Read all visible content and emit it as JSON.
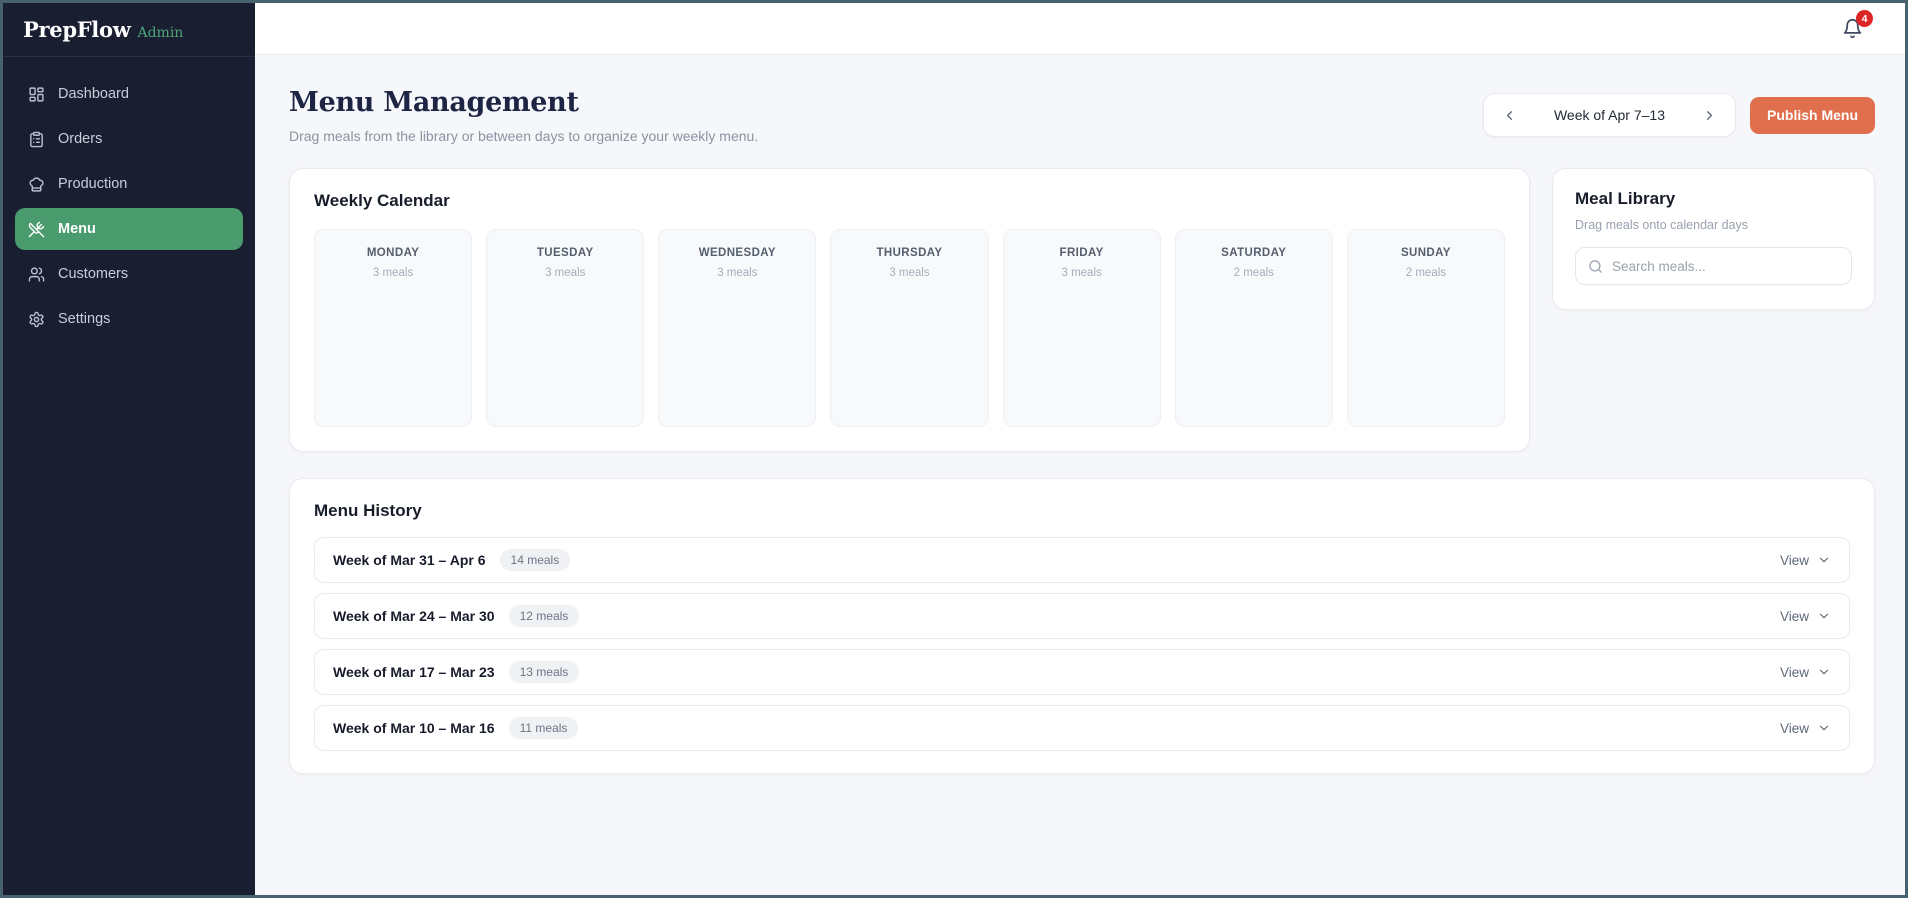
{
  "app": {
    "name": "PrepFlow",
    "suffix": "Admin"
  },
  "colors": {
    "sidebar_bg": "#1a1e31",
    "accent_green": "#4a9b6e",
    "accent_orange": "#e0704d",
    "badge_red": "#dc2626",
    "page_bg": "#f6f7fa"
  },
  "sidebar": {
    "items": [
      {
        "label": "Dashboard",
        "icon": "dashboard-icon",
        "active": false
      },
      {
        "label": "Orders",
        "icon": "clipboard-icon",
        "active": false
      },
      {
        "label": "Production",
        "icon": "chef-hat-icon",
        "active": false
      },
      {
        "label": "Menu",
        "icon": "utensils-icon",
        "active": true
      },
      {
        "label": "Customers",
        "icon": "users-icon",
        "active": false
      },
      {
        "label": "Settings",
        "icon": "gear-icon",
        "active": false
      }
    ]
  },
  "topbar": {
    "notification_count": "4"
  },
  "header": {
    "title": "Menu Management",
    "subtitle": "Drag meals from the library or between days to organize your weekly menu.",
    "week_label": "Week of Apr 7–13",
    "publish_label": "Publish Menu"
  },
  "calendar": {
    "title": "Weekly Calendar",
    "days": [
      {
        "name": "MONDAY",
        "meals": "3 meals"
      },
      {
        "name": "TUESDAY",
        "meals": "3 meals"
      },
      {
        "name": "WEDNESDAY",
        "meals": "3 meals"
      },
      {
        "name": "THURSDAY",
        "meals": "3 meals"
      },
      {
        "name": "FRIDAY",
        "meals": "3 meals"
      },
      {
        "name": "SATURDAY",
        "meals": "2 meals"
      },
      {
        "name": "SUNDAY",
        "meals": "2 meals"
      }
    ]
  },
  "meal_library": {
    "title": "Meal Library",
    "subtitle": "Drag meals onto calendar days",
    "search_placeholder": "Search meals..."
  },
  "menu_history": {
    "title": "Menu History",
    "rows": [
      {
        "week": "Week of Mar 31 – Apr 6",
        "badge": "14 meals",
        "action": "View"
      },
      {
        "week": "Week of Mar 24 – Mar 30",
        "badge": "12 meals",
        "action": "View"
      },
      {
        "week": "Week of Mar 17 – Mar 23",
        "badge": "13 meals",
        "action": "View"
      },
      {
        "week": "Week of Mar 10 – Mar 16",
        "badge": "11 meals",
        "action": "View"
      }
    ]
  }
}
